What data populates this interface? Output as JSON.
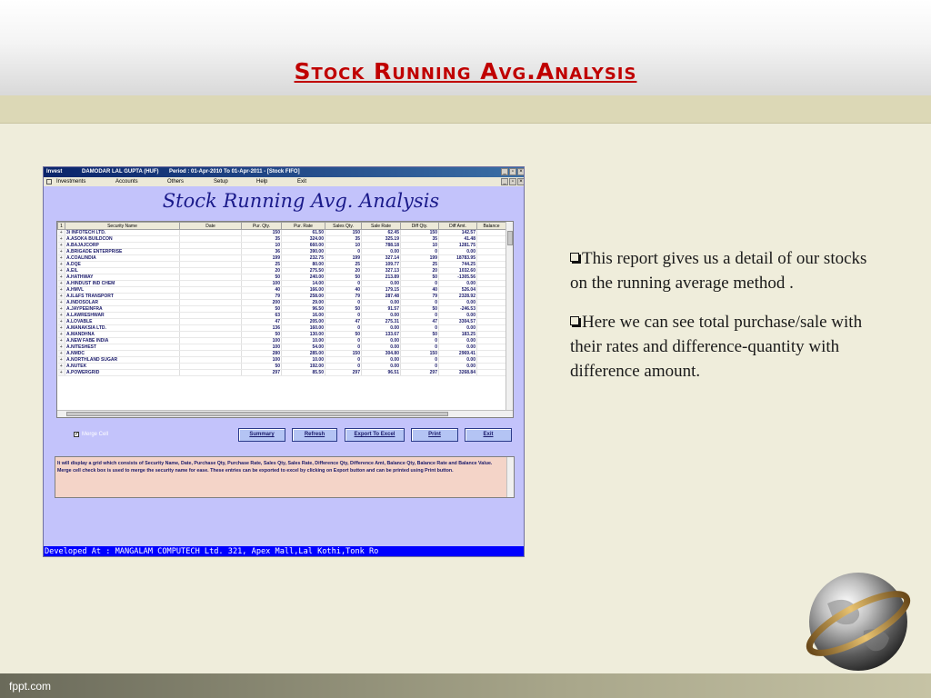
{
  "slide": {
    "title": "Stock Running Avg.Analysis",
    "footer": "fppt.com"
  },
  "window": {
    "app": "Invest",
    "user": "DAMODAR LAL GUPTA (HUF)",
    "period": "Period : 01-Apr-2010  To  01-Apr-2011 - [Stock FIFO]",
    "menu": [
      "Investments",
      "Accounts",
      "Others",
      "Setup",
      "Help",
      "Exit"
    ],
    "report_title": "Stock Running Avg. Analysis",
    "columns": [
      "Security Name",
      "Date",
      "Pur. Qty.",
      "Pur. Rate",
      "Sales Qty.",
      "Sale Rate",
      "Diff Qty.",
      "Diff Amt.",
      "Balance"
    ],
    "rows": [
      [
        "3i INFOTECH LTD.",
        "",
        "150",
        "61.50",
        "150",
        "62.45",
        "150",
        "142.57"
      ],
      [
        "A.ASOKA BUILDCON",
        "",
        "35",
        "324.00",
        "35",
        "325.19",
        "35",
        "41.48"
      ],
      [
        "A.BAJAJCORP",
        "",
        "10",
        "660.00",
        "10",
        "788.18",
        "10",
        "1281.75"
      ],
      [
        "A.BRIGADE ENTERPRISE",
        "",
        "36",
        "390.00",
        "0",
        "0.00",
        "0",
        "0.00"
      ],
      [
        "A.COALINDIA",
        "",
        "199",
        "232.75",
        "199",
        "327.14",
        "199",
        "18783.95"
      ],
      [
        "A.DQE",
        "",
        "25",
        "80.00",
        "25",
        "109.77",
        "25",
        "744.25"
      ],
      [
        "A.EIL",
        "",
        "20",
        "275.50",
        "20",
        "327.13",
        "20",
        "1032.60"
      ],
      [
        "A.HATHWAY",
        "",
        "50",
        "240.00",
        "50",
        "213.89",
        "50",
        "-1305.56"
      ],
      [
        "A.HINDUST IND CHEM",
        "",
        "100",
        "14.00",
        "0",
        "0.00",
        "0",
        "0.00"
      ],
      [
        "A.HMVL",
        "",
        "40",
        "166.00",
        "40",
        "179.15",
        "40",
        "526.04"
      ],
      [
        "A.IL&FS TRANSPORT",
        "",
        "79",
        "258.00",
        "79",
        "287.48",
        "79",
        "2328.92"
      ],
      [
        "A.INDOSOLAR",
        "",
        "200",
        "29.00",
        "0",
        "0.00",
        "0",
        "0.00"
      ],
      [
        "A.JAYPEEINFRA",
        "",
        "50",
        "96.50",
        "50",
        "91.57",
        "50",
        "-246.53"
      ],
      [
        "A.LAWRESHWAR",
        "",
        "63",
        "16.00",
        "0",
        "0.00",
        "0",
        "0.00"
      ],
      [
        "A.LOVABLE",
        "",
        "47",
        "205.00",
        "47",
        "275.31",
        "47",
        "3304.57"
      ],
      [
        "A.MANAKSIA LTD.",
        "",
        "136",
        "160.00",
        "0",
        "0.00",
        "0",
        "0.00"
      ],
      [
        "A.MANDHNA",
        "",
        "50",
        "130.00",
        "50",
        "133.67",
        "50",
        "183.25"
      ],
      [
        "A.NEW FABE INDIA",
        "",
        "100",
        "10.00",
        "0",
        "0.00",
        "0",
        "0.00"
      ],
      [
        "A.NITESHEST",
        "",
        "100",
        "54.00",
        "0",
        "0.00",
        "0",
        "0.00"
      ],
      [
        "A.NMDC",
        "",
        "280",
        "285.00",
        "150",
        "304.80",
        "150",
        "2969.41"
      ],
      [
        "A.NORTHLAND SUGAR",
        "",
        "100",
        "10.00",
        "0",
        "0.00",
        "0",
        "0.00"
      ],
      [
        "A.NUTEK",
        "",
        "50",
        "192.00",
        "0",
        "0.00",
        "0",
        "0.00"
      ],
      [
        "A.POWERGRID",
        "",
        "297",
        "85.50",
        "297",
        "96.51",
        "297",
        "3268.84"
      ]
    ],
    "merge_cell_label": "Merge Cell",
    "buttons": {
      "summary": "Summary",
      "refresh": "Refresh",
      "export": "Export To Excel",
      "print": "Print",
      "exit": "Exit"
    },
    "info": "It will display a grid which consists of Security Name, Date, Purchase Qty, Purchase Rate, Sales Qty, Sales Rate, Difference Qty, Difference Amt, Balance Qty, Balance Rate and Balance Value. Merge cell check box is used to merge the security name for ease. These entries can be exported to excel by clicking on Export button and can be printed using Print button.",
    "statusbar": "Developed At : MANGALAM COMPUTECH Ltd. 321, Apex Mall,Lal Kothi,Tonk Ro"
  },
  "bullets": [
    "This report gives us a detail of our stocks on the running average method .",
    "Here we can see total purchase/sale with their rates and difference-quantity with difference amount."
  ]
}
